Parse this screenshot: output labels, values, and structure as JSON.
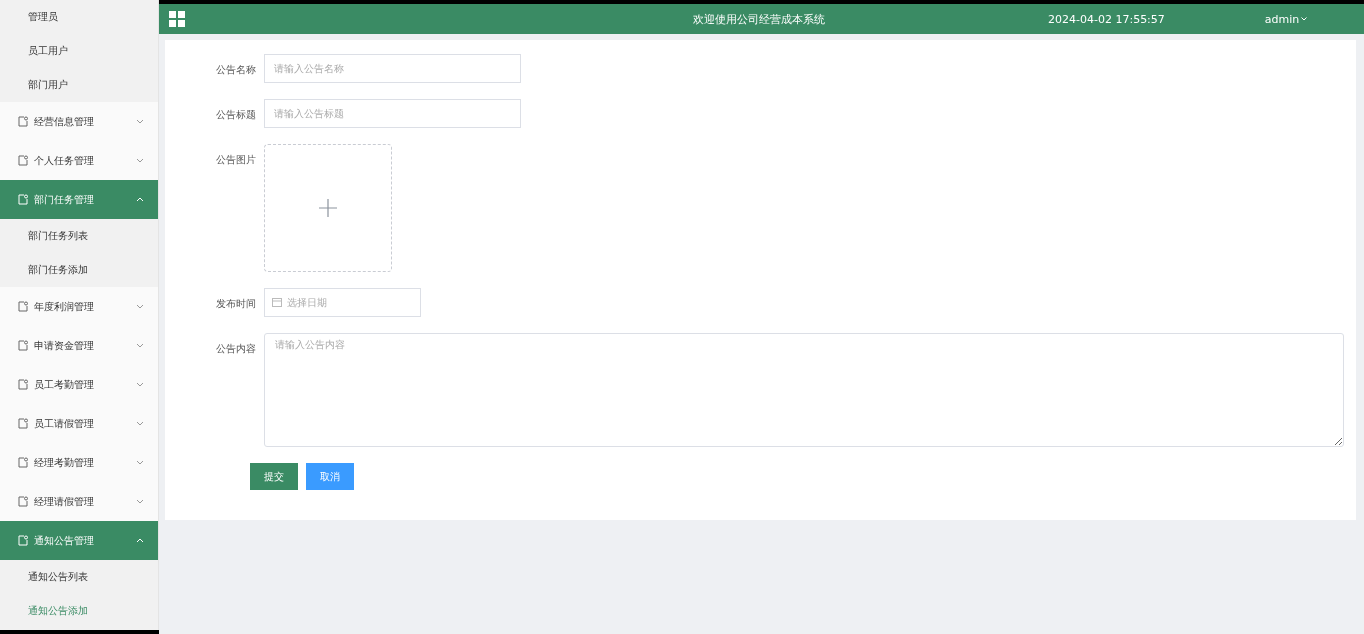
{
  "sidebar": {
    "items": [
      {
        "kind": "link",
        "label": "管理员",
        "selected": false
      },
      {
        "kind": "link",
        "label": "员工用户",
        "selected": false
      },
      {
        "kind": "link",
        "label": "部门用户",
        "selected": false
      },
      {
        "kind": "group",
        "label": "经营信息管理",
        "expanded": false
      },
      {
        "kind": "group",
        "label": "个人任务管理",
        "expanded": false
      },
      {
        "kind": "group",
        "label": "部门任务管理",
        "expanded": true,
        "children": [
          {
            "label": "部门任务列表",
            "selected": false
          },
          {
            "label": "部门任务添加",
            "selected": false
          }
        ]
      },
      {
        "kind": "group",
        "label": "年度利润管理",
        "expanded": false
      },
      {
        "kind": "group",
        "label": "申请资金管理",
        "expanded": false
      },
      {
        "kind": "group",
        "label": "员工考勤管理",
        "expanded": false
      },
      {
        "kind": "group",
        "label": "员工请假管理",
        "expanded": false
      },
      {
        "kind": "group",
        "label": "经理考勤管理",
        "expanded": false
      },
      {
        "kind": "group",
        "label": "经理请假管理",
        "expanded": false
      },
      {
        "kind": "group",
        "label": "通知公告管理",
        "expanded": true,
        "children": [
          {
            "label": "通知公告列表",
            "selected": false
          },
          {
            "label": "通知公告添加",
            "selected": true
          }
        ]
      }
    ]
  },
  "header": {
    "title": "欢迎使用公司经营成本系统",
    "datetime": "2024-04-02 17:55:57",
    "user": "admin"
  },
  "form": {
    "fields": [
      {
        "kind": "text",
        "label": "公告名称",
        "placeholder": "请输入公告名称"
      },
      {
        "kind": "text",
        "label": "公告标题",
        "placeholder": "请输入公告标题"
      },
      {
        "kind": "upload",
        "label": "公告图片"
      },
      {
        "kind": "date",
        "label": "发布时间",
        "placeholder": "选择日期"
      },
      {
        "kind": "textarea",
        "label": "公告内容",
        "placeholder": "请输入公告内容"
      }
    ],
    "buttons": [
      {
        "kind": "primary",
        "label": "提交"
      },
      {
        "kind": "secondary",
        "label": "取消"
      }
    ]
  }
}
